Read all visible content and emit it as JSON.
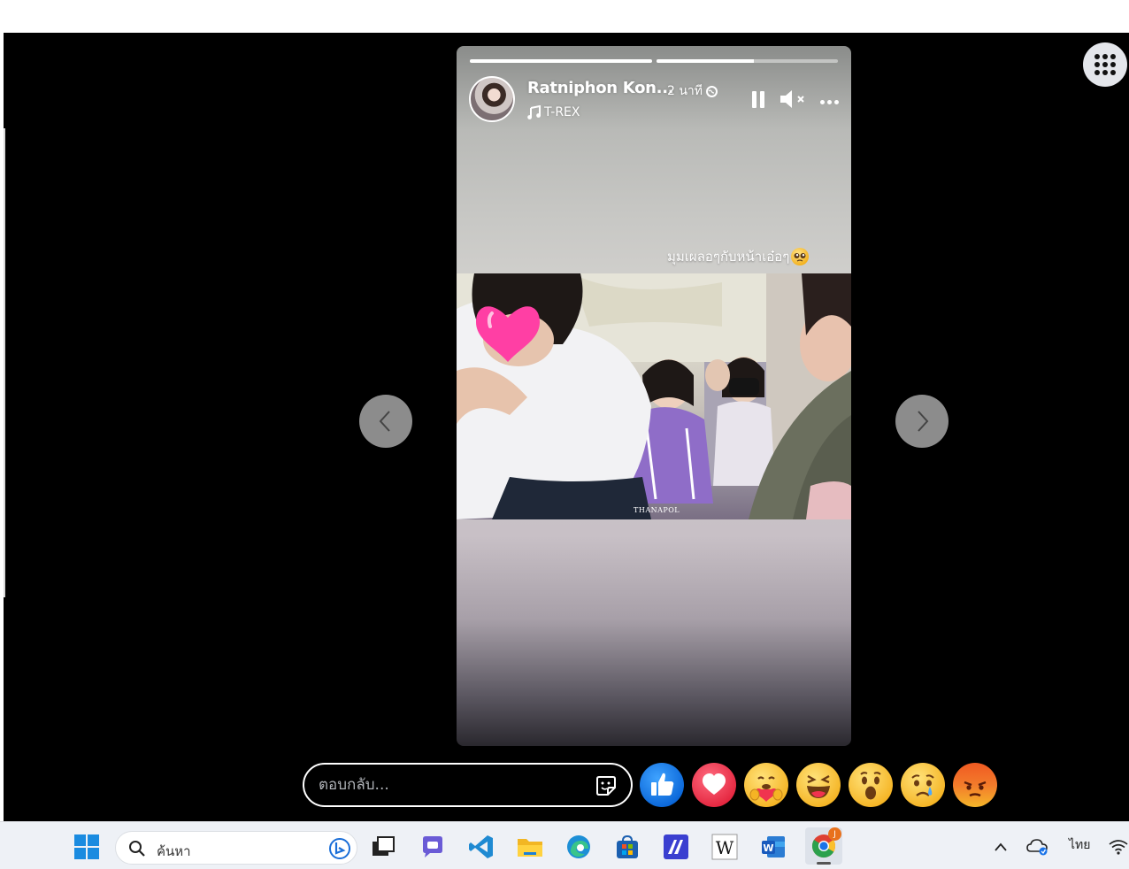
{
  "story": {
    "author_name": "Ratniphon Kon...",
    "time_ago": "2 นาที",
    "music_title": "T-REX",
    "caption": "มุมเผลอๆกับหน้าเอ๋อๆ",
    "watermark": "THANAPOL",
    "progress": [
      1.0,
      0.54
    ]
  },
  "reply": {
    "placeholder": "ตอบกลับ..."
  },
  "reactions": [
    "like",
    "love",
    "care",
    "haha",
    "wow",
    "sad",
    "angry"
  ],
  "taskbar": {
    "search_placeholder": "ค้นหา",
    "language": "ไทย",
    "apps": [
      "windows-start",
      "bing",
      "task-view",
      "teams",
      "vscode",
      "file-explorer",
      "edge",
      "store",
      "affinity",
      "wikipedia",
      "word",
      "chrome"
    ],
    "chrome_badge": "J"
  },
  "colors": {
    "viewer_bg": "#000000",
    "like_blue": "#0a66d8",
    "love_red": "#e4263f",
    "taskbar_bg": "#eef1f6"
  }
}
